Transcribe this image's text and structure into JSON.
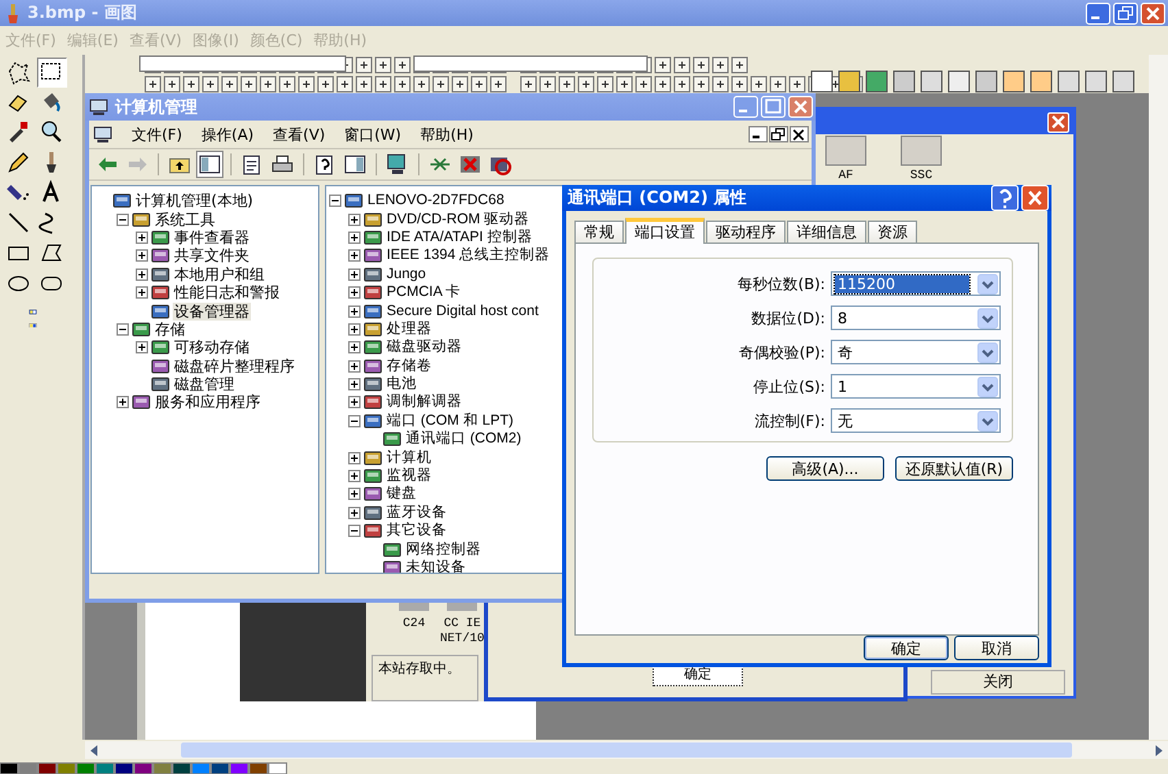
{
  "paint_window": {
    "title": "3.bmp - 画图",
    "menu": [
      "文件(F)",
      "编辑(E)",
      "查看(V)",
      "图像(I)",
      "颜色(C)",
      "帮助(H)"
    ]
  },
  "image": {
    "back_window": {
      "devices": [
        {
          "label": "AF"
        },
        {
          "label": "SSC"
        }
      ],
      "close_button": "关闭"
    },
    "station_window": {
      "devices": [
        {
          "label": "C24"
        },
        {
          "label": "CC IE",
          "sublabel": "NET/10"
        }
      ],
      "status": "本站存取中。",
      "ok_button": "确定"
    }
  },
  "mgmt_window": {
    "title": "计算机管理",
    "menu": [
      "文件(F)",
      "操作(A)",
      "查看(V)",
      "窗口(W)",
      "帮助(H)"
    ],
    "console_tree": [
      {
        "label": "计算机管理(本地)",
        "selected": false,
        "children": [
          {
            "label": "系统工具",
            "expanded": true,
            "selected": false,
            "children": [
              {
                "label": "事件查看器",
                "expanded": false,
                "selected": false
              },
              {
                "label": "共享文件夹",
                "expanded": false,
                "selected": false
              },
              {
                "label": "本地用户和组",
                "expanded": false,
                "selected": false
              },
              {
                "label": "性能日志和警报",
                "expanded": false,
                "selected": false
              },
              {
                "label": "设备管理器",
                "selected": true
              }
            ]
          },
          {
            "label": "存储",
            "expanded": true,
            "selected": false,
            "children": [
              {
                "label": "可移动存储",
                "expanded": false,
                "selected": false
              },
              {
                "label": "磁盘碎片整理程序",
                "selected": false
              },
              {
                "label": "磁盘管理",
                "selected": false
              }
            ]
          },
          {
            "label": "服务和应用程序",
            "expanded": false,
            "selected": false
          }
        ]
      }
    ],
    "device_tree": [
      {
        "label": "LENOVO-2D7FDC68",
        "expanded": true,
        "children": [
          {
            "label": "DVD/CD-ROM 驱动器",
            "expanded": false
          },
          {
            "label": "IDE ATA/ATAPI 控制器",
            "expanded": false
          },
          {
            "label": "IEEE 1394 总线主控制器",
            "expanded": false
          },
          {
            "label": "Jungo",
            "expanded": false
          },
          {
            "label": "PCMCIA 卡",
            "expanded": false
          },
          {
            "label": "Secure Digital host cont",
            "expanded": false
          },
          {
            "label": "处理器",
            "expanded": false
          },
          {
            "label": "磁盘驱动器",
            "expanded": false
          },
          {
            "label": "存储卷",
            "expanded": false
          },
          {
            "label": "电池",
            "expanded": false
          },
          {
            "label": "调制解调器",
            "expanded": false
          },
          {
            "label": "端口 (COM 和 LPT)",
            "expanded": true,
            "children": [
              {
                "label": "通讯端口 (COM2)"
              }
            ]
          },
          {
            "label": "计算机",
            "expanded": false
          },
          {
            "label": "监视器",
            "expanded": false
          },
          {
            "label": "键盘",
            "expanded": false
          },
          {
            "label": "蓝牙设备",
            "expanded": false
          },
          {
            "label": "其它设备",
            "expanded": true,
            "children": [
              {
                "label": "网络控制器"
              },
              {
                "label": "未知设备"
              }
            ]
          }
        ]
      }
    ]
  },
  "properties_dialog": {
    "title": "通讯端口 (COM2) 属性",
    "tabs": [
      {
        "label": "常规",
        "selected": false
      },
      {
        "label": "端口设置",
        "selected": true
      },
      {
        "label": "驱动程序",
        "selected": false
      },
      {
        "label": "详细信息",
        "selected": false
      },
      {
        "label": "资源",
        "selected": false
      }
    ],
    "fields": [
      {
        "label": "每秒位数(B):",
        "value": "115200",
        "selected": true
      },
      {
        "label": "数据位(D):",
        "value": "8",
        "selected": false
      },
      {
        "label": "奇偶校验(P):",
        "value": "奇",
        "selected": false
      },
      {
        "label": "停止位(S):",
        "value": "1",
        "selected": false
      },
      {
        "label": "流控制(F):",
        "value": "无",
        "selected": false
      }
    ],
    "panel_buttons": [
      "高级(A)...",
      "还原默认值(R)"
    ],
    "buttons": [
      "确定",
      "取消"
    ]
  }
}
